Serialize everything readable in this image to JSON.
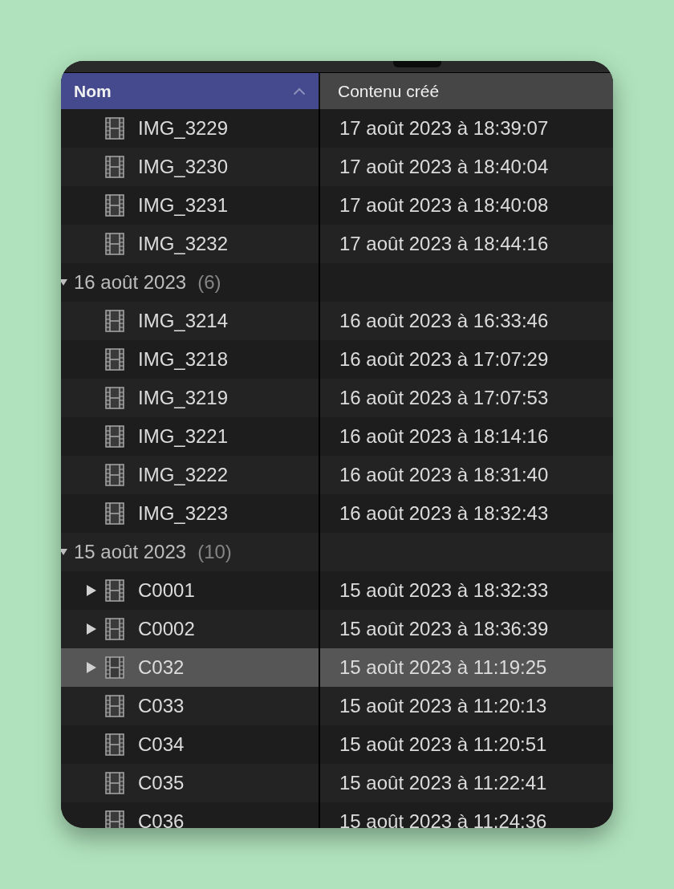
{
  "columns": [
    {
      "label": "Nom",
      "selected": true,
      "sorted": true
    },
    {
      "label": "Contenu créé",
      "selected": false
    }
  ],
  "groups": [
    {
      "items": [
        {
          "name": "IMG_3229",
          "created": "17 août 2023 à 18:39:07",
          "expandable": false,
          "selected": false
        },
        {
          "name": "IMG_3230",
          "created": "17 août 2023 à 18:40:04",
          "expandable": false,
          "selected": false
        },
        {
          "name": "IMG_3231",
          "created": "17 août 2023 à 18:40:08",
          "expandable": false,
          "selected": false
        },
        {
          "name": "IMG_3232",
          "created": "17 août 2023 à 18:44:16",
          "expandable": false,
          "selected": false
        }
      ]
    },
    {
      "label": "16 août 2023",
      "count": "(6)",
      "expanded": true,
      "items": [
        {
          "name": "IMG_3214",
          "created": "16 août 2023 à 16:33:46",
          "expandable": false,
          "selected": false
        },
        {
          "name": "IMG_3218",
          "created": "16 août 2023 à 17:07:29",
          "expandable": false,
          "selected": false
        },
        {
          "name": "IMG_3219",
          "created": "16 août 2023 à 17:07:53",
          "expandable": false,
          "selected": false
        },
        {
          "name": "IMG_3221",
          "created": "16 août 2023 à 18:14:16",
          "expandable": false,
          "selected": false
        },
        {
          "name": "IMG_3222",
          "created": "16 août 2023 à 18:31:40",
          "expandable": false,
          "selected": false
        },
        {
          "name": "IMG_3223",
          "created": "16 août 2023 à 18:32:43",
          "expandable": false,
          "selected": false
        }
      ]
    },
    {
      "label": "15 août 2023",
      "count": "(10)",
      "expanded": true,
      "items": [
        {
          "name": "C0001",
          "created": "15 août 2023 à 18:32:33",
          "expandable": true,
          "selected": false
        },
        {
          "name": "C0002",
          "created": "15 août 2023 à 18:36:39",
          "expandable": true,
          "selected": false
        },
        {
          "name": "C032",
          "created": "15 août 2023 à 11:19:25",
          "expandable": true,
          "selected": true
        },
        {
          "name": "C033",
          "created": "15 août 2023 à 11:20:13",
          "expandable": false,
          "selected": false
        },
        {
          "name": "C034",
          "created": "15 août 2023 à 11:20:51",
          "expandable": false,
          "selected": false
        },
        {
          "name": "C035",
          "created": "15 août 2023 à 11:22:41",
          "expandable": false,
          "selected": false
        },
        {
          "name": "C036",
          "created": "15 août 2023 à 11:24:36",
          "expandable": false,
          "selected": false
        }
      ]
    }
  ]
}
